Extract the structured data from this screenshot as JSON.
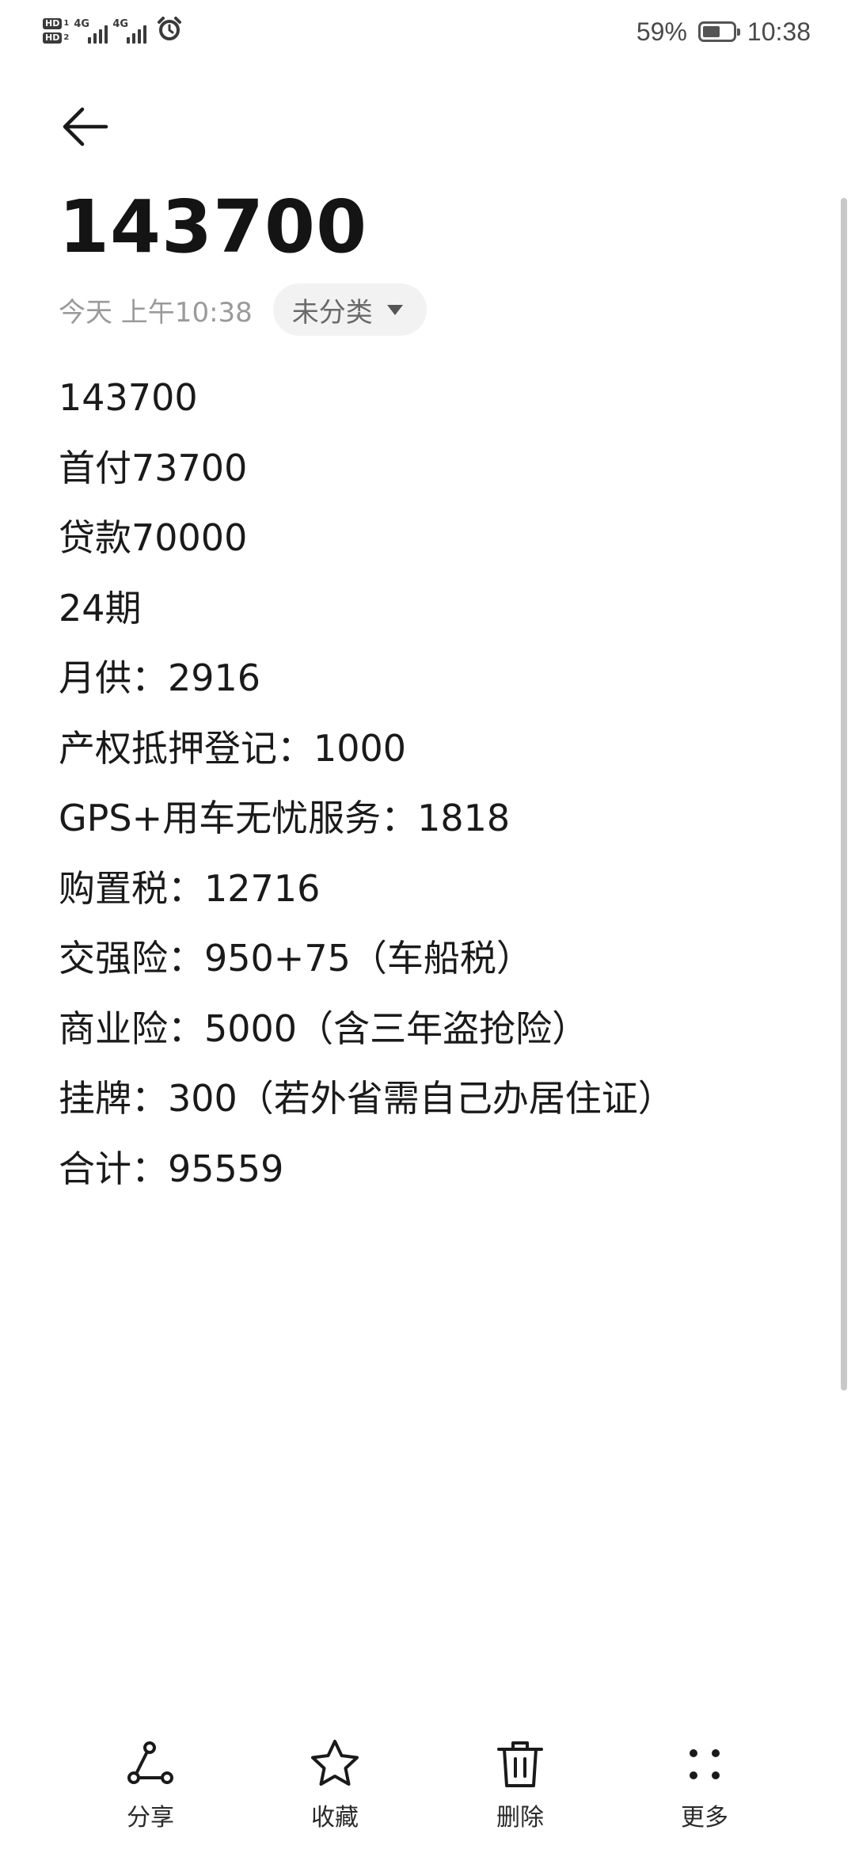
{
  "status_bar": {
    "network_left": "4G",
    "network_right": "4G",
    "battery_text": "59%",
    "battery_level": 0.59,
    "time": "10:38"
  },
  "note": {
    "title": "143700",
    "date": "今天 上午10:38",
    "category": "未分类",
    "lines": [
      "143700",
      "首付73700",
      "贷款70000",
      "24期",
      "月供：2916",
      "产权抵押登记：1000",
      "GPS+用车无忧服务：1818",
      "购置税：12716",
      "交强险：950+75（车船税）",
      "商业险：5000（含三年盗抢险）",
      "挂牌：300（若外省需自己办居住证）",
      "合计：95559"
    ]
  },
  "toolbar": {
    "share_label": "分享",
    "favorite_label": "收藏",
    "delete_label": "删除",
    "more_label": "更多"
  },
  "icons": {
    "back": "arrow-left-icon",
    "share": "share-icon",
    "favorite": "star-icon",
    "delete": "trash-icon",
    "more": "more-dots-icon",
    "alarm": "alarm-clock-icon"
  }
}
